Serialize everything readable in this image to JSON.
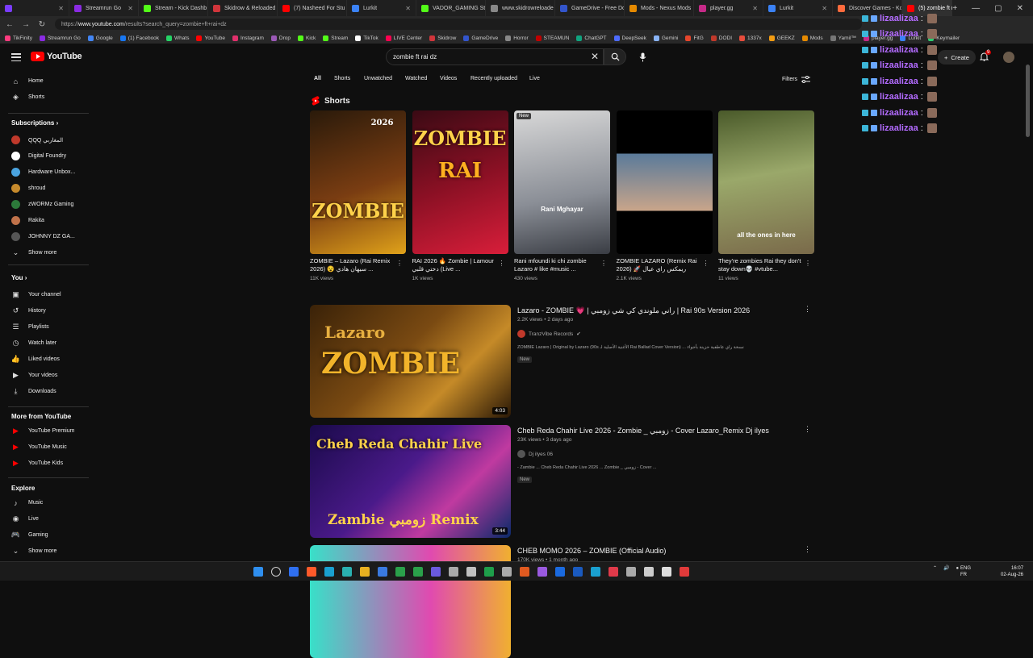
{
  "browser": {
    "tabs": [
      {
        "label": "",
        "color": "#7a3cff"
      },
      {
        "label": "Streamrun Go",
        "color": "#8a2be2"
      },
      {
        "label": "Stream - Kick Dashb",
        "color": "#53fc18"
      },
      {
        "label": "Skidrow & Reloaded",
        "color": "#d0353b"
      },
      {
        "label": "(7) Nasheed For Stu",
        "color": "#ff0000"
      },
      {
        "label": "Lurkit",
        "color": "#3b82f6"
      },
      {
        "label": "VADOR_GAMING Stre",
        "color": "#53fc18"
      },
      {
        "label": "www.skidrowreloade",
        "color": "#888888"
      },
      {
        "label": "GameDrive - Free Do",
        "color": "#3355cc"
      },
      {
        "label": "Mods - Nexus Mods",
        "color": "#e68a00"
      },
      {
        "label": "player.gg",
        "color": "#c62a88"
      },
      {
        "label": "Lurkit",
        "color": "#3b82f6"
      },
      {
        "label": "Discover Games - Ko",
        "color": "#ff6b3d"
      },
      {
        "label": "(5) zombie ft rai",
        "color": "#ff0000"
      }
    ],
    "url_prefix": "https://",
    "url_domain": "www.youtube.com",
    "url_path": "/results?search_query=zombie+ft+rai+dz",
    "bookmarks": [
      {
        "label": "TikFinity",
        "color": "#ff3b7f"
      },
      {
        "label": "Streamrun Go",
        "color": "#8a2be2"
      },
      {
        "label": "Google",
        "color": "#4285f4"
      },
      {
        "label": "(1) Facebook",
        "color": "#1877f2"
      },
      {
        "label": "Whats",
        "color": "#25d366"
      },
      {
        "label": "YouTube",
        "color": "#ff0000"
      },
      {
        "label": "Instagram",
        "color": "#e1306c"
      },
      {
        "label": "Drop",
        "color": "#9b59b6"
      },
      {
        "label": "Kick",
        "color": "#53fc18"
      },
      {
        "label": "Stream",
        "color": "#53fc18"
      },
      {
        "label": "TikTok",
        "color": "#ffffff"
      },
      {
        "label": "LIVE Center",
        "color": "#ff0050"
      },
      {
        "label": "Skidrow",
        "color": "#d0353b"
      },
      {
        "label": "GameDrive",
        "color": "#3355cc"
      },
      {
        "label": "Horror",
        "color": "#888888"
      },
      {
        "label": "STEAMUN",
        "color": "#c00000"
      },
      {
        "label": "ChatGPT",
        "color": "#10a37f"
      },
      {
        "label": "DeepSeek",
        "color": "#4d6bfe"
      },
      {
        "label": "Gemini",
        "color": "#8ab4f8"
      },
      {
        "label": "FitG",
        "color": "#e6462c"
      },
      {
        "label": "DODI",
        "color": "#c0392b"
      },
      {
        "label": "1337x",
        "color": "#e74c3c"
      },
      {
        "label": "GEEKZ",
        "color": "#f39c12"
      },
      {
        "label": "Mods",
        "color": "#e68a00"
      },
      {
        "label": "Yamil™",
        "color": "#777777"
      },
      {
        "label": "player.gg",
        "color": "#c62a88"
      },
      {
        "label": "Lurkit",
        "color": "#3b82f6"
      },
      {
        "label": "Keymailer",
        "color": "#2ecc71"
      }
    ]
  },
  "header": {
    "logo_text": "YouTube",
    "search_value": "zombie ft rai dz",
    "create_label": "Create",
    "notif_count": "9"
  },
  "chat": {
    "lines": [
      {
        "name": "lizaalizaa",
        "sep": ":"
      },
      {
        "name": "lizaalizaa",
        "sep": ":"
      },
      {
        "name": "lizaalizaa",
        "sep": ":"
      },
      {
        "name": "lizaalizaa",
        "sep": ":"
      },
      {
        "name": "lizaalizaa",
        "sep": ":"
      },
      {
        "name": "lizaalizaa",
        "sep": ":"
      },
      {
        "name": "lizaalizaa",
        "sep": ":"
      },
      {
        "name": "lizaalizaa",
        "sep": ":"
      }
    ]
  },
  "sidebar": {
    "main": [
      {
        "label": "Home",
        "icon": "home-icon",
        "glyph": "⌂"
      },
      {
        "label": "Shorts",
        "icon": "shorts-icon",
        "glyph": "◈"
      }
    ],
    "subs_heading": "Subscriptions",
    "subs": [
      {
        "label": "QQQ المغاربي",
        "color": "#c0392b"
      },
      {
        "label": "Digital Foundry",
        "color": "#ffffff"
      },
      {
        "label": "Hardware Unbox...",
        "color": "#4aa3df"
      },
      {
        "label": "shroud",
        "color": "#c68a2c"
      },
      {
        "label": "zWORMz Gaming",
        "color": "#2c7a3a"
      },
      {
        "label": "Rakita",
        "color": "#c0724a"
      },
      {
        "label": "JOHNNY DZ GA...",
        "color": "#555555"
      }
    ],
    "show_more": "Show more",
    "you_heading": "You",
    "you": [
      {
        "label": "Your channel",
        "icon": "channel-icon",
        "glyph": "▣"
      },
      {
        "label": "History",
        "icon": "history-icon",
        "glyph": "↺"
      },
      {
        "label": "Playlists",
        "icon": "playlists-icon",
        "glyph": "☰"
      },
      {
        "label": "Watch later",
        "icon": "clock-icon",
        "glyph": "◷"
      },
      {
        "label": "Liked videos",
        "icon": "like-icon",
        "glyph": "👍"
      },
      {
        "label": "Your videos",
        "icon": "video-icon",
        "glyph": "▶"
      },
      {
        "label": "Downloads",
        "icon": "download-icon",
        "glyph": "⤓"
      }
    ],
    "more_heading": "More from YouTube",
    "more": [
      {
        "label": "YouTube Premium"
      },
      {
        "label": "YouTube Music"
      },
      {
        "label": "YouTube Kids"
      }
    ],
    "explore_heading": "Explore",
    "explore": [
      {
        "label": "Music",
        "icon": "music-icon",
        "glyph": "♪"
      },
      {
        "label": "Live",
        "icon": "live-icon",
        "glyph": "◉"
      },
      {
        "label": "Gaming",
        "icon": "gaming-icon",
        "glyph": "🎮"
      }
    ],
    "explore_more": "Show more"
  },
  "chips": [
    "All",
    "Shorts",
    "Unwatched",
    "Watched",
    "Videos",
    "Recently uploaded",
    "Live"
  ],
  "filters_label": "Filters",
  "shorts": {
    "heading": "Shorts",
    "items": [
      {
        "title": "ZOMBIE – Lazaro (Rai Remix 2026) 😵 سيهان هادي ...",
        "views": "11K views",
        "overlay": "ZOMBIE",
        "overlay2": "2026",
        "bg": "linear-gradient(160deg,#2a1a0a,#7a3d12 55%,#e0a21a)",
        "tag": ""
      },
      {
        "title": "RAI 2026 🔥 Zombie | Lamour دختي قلبي (Live ...",
        "views": "1K views",
        "overlay": "ZOMBIE",
        "overlay2": "RAI",
        "bg": "linear-gradient(160deg,#3a0a14,#8a1024 50%,#d81e3a)",
        "tag": ""
      },
      {
        "title": "Rani mfoundi ki chi zombie Lazaro # like #music ...",
        "views": "430 views",
        "overlay": "Rani Mghayar",
        "overlay2": "",
        "bg": "linear-gradient(170deg,#d8d8d8,#8a8e96 60%,#3a3d44)",
        "tag": "New"
      },
      {
        "title": "ZOMBIE LAZARO (Remix Rai 2026) 🚀 ريمكس راي عيال",
        "views": "2.1K views",
        "overlay": "",
        "overlay2": "",
        "bg": "linear-gradient(180deg,#000 0%,#000 30%,#5a7a9a 30%,#c9a58a 70%,#000 70%)",
        "tag": ""
      },
      {
        "title": "They're zombies Rai they don't stay down💀 #vtube...",
        "views": "11 views",
        "overlay": "all the ones in here",
        "overlay2": "",
        "bg": "linear-gradient(170deg,#4a5a2a,#9aa86a 45%,#7a6a4a)",
        "tag": ""
      }
    ]
  },
  "videos": [
    {
      "title": "Lazaro - ZOMBIE 💗 | راني ملوندي كي شي زومبي | Rai 90s Version 2026",
      "views": "2.2K views",
      "age": "2 days ago",
      "channel": "TranzVibe Records",
      "verified": "✔",
      "desc": "ZOMBIE Lazaro | Original by Lazaro (90s الأغنية الأصلية لـ Rai Ballad Cover Version) ... نسخة راي عاطفية حزينة بأجواء",
      "new": "New",
      "duration": "4:03",
      "thumb_text": "ZOMBIE",
      "thumb_text2": "Lazaro",
      "bg": "linear-gradient(135deg,#3a2208,#7a4a12 45%,#c58a28 70%,#2a1806)",
      "ch_color": "#c0392b"
    },
    {
      "title": "Cheb Reda Chahir Live 2026 - Zombie _ زومبي - Cover Lazaro_Remix Dj ilyes",
      "views": "23K views",
      "age": "3 days ago",
      "channel": "Dj ilyes 06",
      "verified": "",
      "desc": "- Zambie ... Cheb Reda Chahir Live 2026 ... Zombie _ زومبي - Cover ...",
      "new": "New",
      "duration": "3:44",
      "thumb_text": "Cheb Reda Chahir Live",
      "thumb_text2": "Zambie  زومبي  Remix",
      "bg": "linear-gradient(135deg,#1a0a4a,#4a1a8a 45%,#c03aa0 70%,#0a2a6a)",
      "ch_color": "#555555"
    },
    {
      "title": "CHEB MOMO 2026 – ZOMBIE (Official Audio)",
      "views": "170K views",
      "age": "1 month ago",
      "channel": "",
      "verified": "",
      "desc": "",
      "new": "",
      "duration": "",
      "thumb_text": "",
      "thumb_text2": "",
      "bg": "linear-gradient(90deg,#38e0c8,#e04ab0 60%,#f0b030)",
      "ch_color": "#555555"
    }
  ],
  "taskbar": {
    "lang1": "ENG",
    "lang2": "FR",
    "time": "16:07",
    "date": "02-Aug-26"
  },
  "colors": {
    "accent": "#ff0000",
    "chat_name": "#b36bff"
  }
}
